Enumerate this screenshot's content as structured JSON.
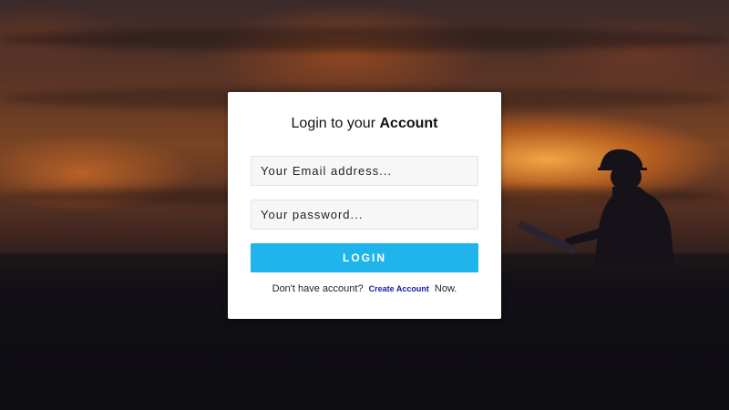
{
  "login": {
    "title_prefix": "Login to your",
    "title_emphasis": "Account",
    "email_placeholder": "Your Email address...",
    "password_placeholder": "Your password...",
    "button_label": "LOGIN",
    "footer_prefix": "Don't have account?",
    "footer_link": "Create Account",
    "footer_suffix": "Now."
  },
  "colors": {
    "button": "#1fb5ec",
    "link": "#1a1aa6",
    "card": "#ffffff"
  }
}
